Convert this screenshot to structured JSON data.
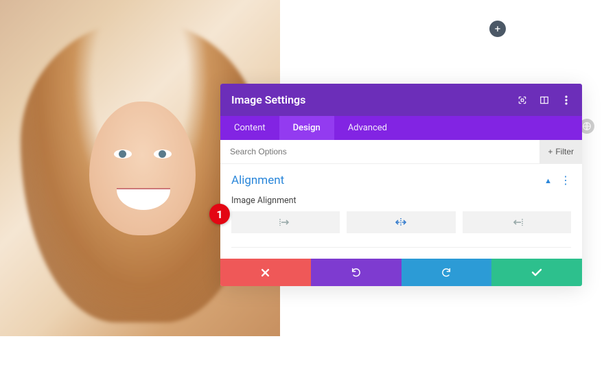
{
  "modal": {
    "title": "Image Settings",
    "tabs": [
      "Content",
      "Design",
      "Advanced"
    ],
    "active_tab": 1,
    "search_placeholder": "Search Options",
    "filter_label": "Filter"
  },
  "section": {
    "title": "Alignment",
    "field_label": "Image Alignment",
    "options": [
      "left",
      "center",
      "right"
    ],
    "active_option": 1
  },
  "footer": {
    "cancel": "cancel",
    "undo": "undo",
    "redo": "redo",
    "confirm": "confirm"
  },
  "annotation": {
    "marker": "1"
  },
  "icons": {
    "add": "+",
    "expand": "expand-icon",
    "columns": "columns-icon",
    "menu": "menu-icon",
    "caret_up": "▲",
    "dots": "⋮",
    "plus": "+"
  }
}
